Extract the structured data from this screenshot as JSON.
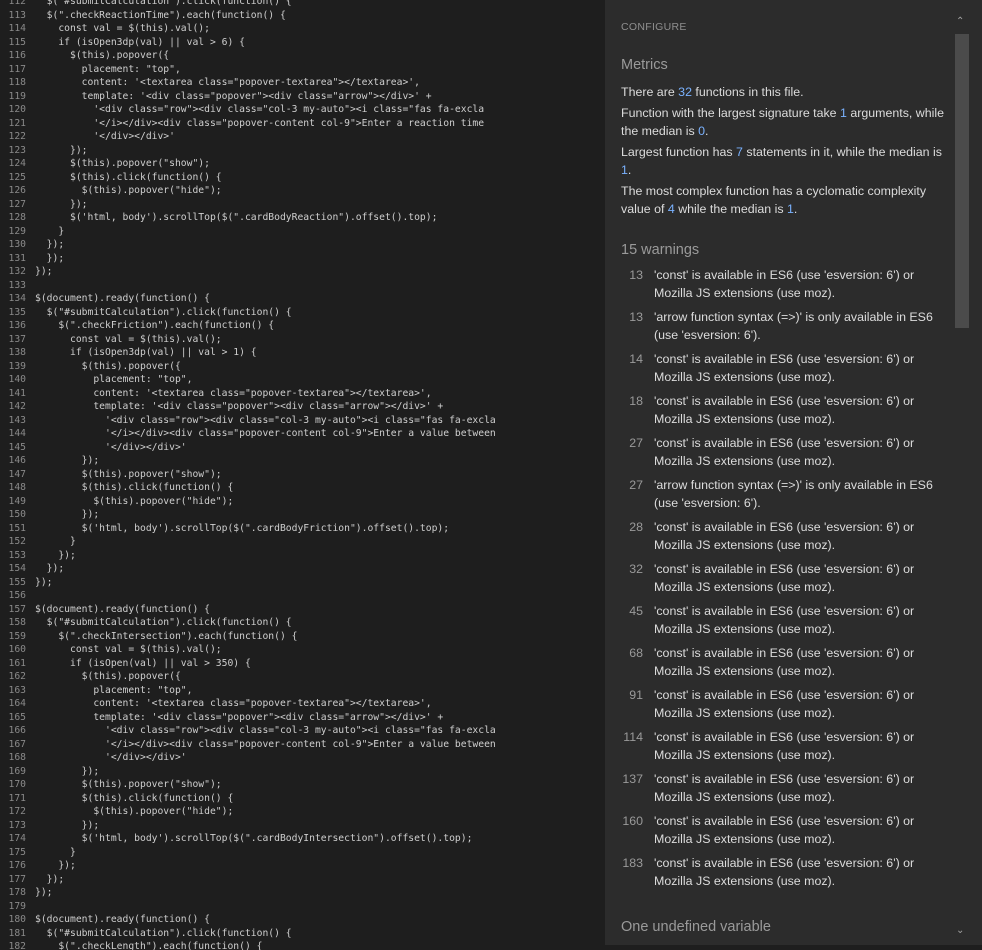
{
  "code_lines": [
    {
      "n": "112",
      "t": "  $(\"#submitCalculation\").click(function() {"
    },
    {
      "n": "113",
      "t": "  $(\".checkReactionTime\").each(function() {"
    },
    {
      "n": "114",
      "t": "    const val = $(this).val();"
    },
    {
      "n": "115",
      "t": "    if (isOpen3dp(val) || val > 6) {"
    },
    {
      "n": "116",
      "t": "      $(this).popover({"
    },
    {
      "n": "117",
      "t": "        placement: \"top\","
    },
    {
      "n": "118",
      "t": "        content: '<textarea class=\"popover-textarea\"></textarea>',"
    },
    {
      "n": "119",
      "t": "        template: '<div class=\"popover\"><div class=\"arrow\"></div>' +"
    },
    {
      "n": "120",
      "t": "          '<div class=\"row\"><div class=\"col-3 my-auto\"><i class=\"fas fa-excla"
    },
    {
      "n": "121",
      "t": "          '</i></div><div class=\"popover-content col-9\">Enter a reaction time"
    },
    {
      "n": "122",
      "t": "          '</div></div>'"
    },
    {
      "n": "123",
      "t": "      });"
    },
    {
      "n": "124",
      "t": "      $(this).popover(\"show\");"
    },
    {
      "n": "125",
      "t": "      $(this).click(function() {"
    },
    {
      "n": "126",
      "t": "        $(this).popover(\"hide\");"
    },
    {
      "n": "127",
      "t": "      });"
    },
    {
      "n": "128",
      "t": "      $('html, body').scrollTop($(\".cardBodyReaction\").offset().top);"
    },
    {
      "n": "129",
      "t": "    }"
    },
    {
      "n": "130",
      "t": "  });"
    },
    {
      "n": "131",
      "t": "  });"
    },
    {
      "n": "132",
      "t": "});"
    },
    {
      "n": "133",
      "t": ""
    },
    {
      "n": "134",
      "t": "$(document).ready(function() {"
    },
    {
      "n": "135",
      "t": "  $(\"#submitCalculation\").click(function() {"
    },
    {
      "n": "136",
      "t": "    $(\".checkFriction\").each(function() {"
    },
    {
      "n": "137",
      "t": "      const val = $(this).val();"
    },
    {
      "n": "138",
      "t": "      if (isOpen3dp(val) || val > 1) {"
    },
    {
      "n": "139",
      "t": "        $(this).popover({"
    },
    {
      "n": "140",
      "t": "          placement: \"top\","
    },
    {
      "n": "141",
      "t": "          content: '<textarea class=\"popover-textarea\"></textarea>',"
    },
    {
      "n": "142",
      "t": "          template: '<div class=\"popover\"><div class=\"arrow\"></div>' +"
    },
    {
      "n": "143",
      "t": "            '<div class=\"row\"><div class=\"col-3 my-auto\"><i class=\"fas fa-excla"
    },
    {
      "n": "144",
      "t": "            '</i></div><div class=\"popover-content col-9\">Enter a value between"
    },
    {
      "n": "145",
      "t": "            '</div></div>'"
    },
    {
      "n": "146",
      "t": "        });"
    },
    {
      "n": "147",
      "t": "        $(this).popover(\"show\");"
    },
    {
      "n": "148",
      "t": "        $(this).click(function() {"
    },
    {
      "n": "149",
      "t": "          $(this).popover(\"hide\");"
    },
    {
      "n": "150",
      "t": "        });"
    },
    {
      "n": "151",
      "t": "        $('html, body').scrollTop($(\".cardBodyFriction\").offset().top);"
    },
    {
      "n": "152",
      "t": "      }"
    },
    {
      "n": "153",
      "t": "    });"
    },
    {
      "n": "154",
      "t": "  });"
    },
    {
      "n": "155",
      "t": "});"
    },
    {
      "n": "156",
      "t": ""
    },
    {
      "n": "157",
      "t": "$(document).ready(function() {"
    },
    {
      "n": "158",
      "t": "  $(\"#submitCalculation\").click(function() {"
    },
    {
      "n": "159",
      "t": "    $(\".checkIntersection\").each(function() {"
    },
    {
      "n": "160",
      "t": "      const val = $(this).val();"
    },
    {
      "n": "161",
      "t": "      if (isOpen(val) || val > 350) {"
    },
    {
      "n": "162",
      "t": "        $(this).popover({"
    },
    {
      "n": "163",
      "t": "          placement: \"top\","
    },
    {
      "n": "164",
      "t": "          content: '<textarea class=\"popover-textarea\"></textarea>',"
    },
    {
      "n": "165",
      "t": "          template: '<div class=\"popover\"><div class=\"arrow\"></div>' +"
    },
    {
      "n": "166",
      "t": "            '<div class=\"row\"><div class=\"col-3 my-auto\"><i class=\"fas fa-excla"
    },
    {
      "n": "167",
      "t": "            '</i></div><div class=\"popover-content col-9\">Enter a value between"
    },
    {
      "n": "168",
      "t": "            '</div></div>'"
    },
    {
      "n": "169",
      "t": "        });"
    },
    {
      "n": "170",
      "t": "        $(this).popover(\"show\");"
    },
    {
      "n": "171",
      "t": "        $(this).click(function() {"
    },
    {
      "n": "172",
      "t": "          $(this).popover(\"hide\");"
    },
    {
      "n": "173",
      "t": "        });"
    },
    {
      "n": "174",
      "t": "        $('html, body').scrollTop($(\".cardBodyIntersection\").offset().top);"
    },
    {
      "n": "175",
      "t": "      }"
    },
    {
      "n": "176",
      "t": "    });"
    },
    {
      "n": "177",
      "t": "  });"
    },
    {
      "n": "178",
      "t": "});"
    },
    {
      "n": "179",
      "t": ""
    },
    {
      "n": "180",
      "t": "$(document).ready(function() {"
    },
    {
      "n": "181",
      "t": "  $(\"#submitCalculation\").click(function() {"
    },
    {
      "n": "182",
      "t": "    $(\".checkLength\").each(function() {"
    }
  ],
  "panel": {
    "configure_label": "CONFIGURE",
    "metrics_title": "Metrics",
    "metrics": {
      "functions_count": "32",
      "largest_signature_args": "1",
      "median_signature": "0",
      "largest_statements": "7",
      "median_statements": "1",
      "max_complexity": "4",
      "median_complexity": "1"
    },
    "warnings_title": "15 warnings",
    "warnings": [
      {
        "line": "13",
        "msg": "'const' is available in ES6 (use 'esversion: 6') or Mozilla JS extensions (use moz)."
      },
      {
        "line": "13",
        "msg": "'arrow function syntax (=>)' is only available in ES6 (use 'esversion: 6')."
      },
      {
        "line": "14",
        "msg": "'const' is available in ES6 (use 'esversion: 6') or Mozilla JS extensions (use moz)."
      },
      {
        "line": "18",
        "msg": "'const' is available in ES6 (use 'esversion: 6') or Mozilla JS extensions (use moz)."
      },
      {
        "line": "27",
        "msg": "'const' is available in ES6 (use 'esversion: 6') or Mozilla JS extensions (use moz)."
      },
      {
        "line": "27",
        "msg": "'arrow function syntax (=>)' is only available in ES6 (use 'esversion: 6')."
      },
      {
        "line": "28",
        "msg": "'const' is available in ES6 (use 'esversion: 6') or Mozilla JS extensions (use moz)."
      },
      {
        "line": "32",
        "msg": "'const' is available in ES6 (use 'esversion: 6') or Mozilla JS extensions (use moz)."
      },
      {
        "line": "45",
        "msg": "'const' is available in ES6 (use 'esversion: 6') or Mozilla JS extensions (use moz)."
      },
      {
        "line": "68",
        "msg": "'const' is available in ES6 (use 'esversion: 6') or Mozilla JS extensions (use moz)."
      },
      {
        "line": "91",
        "msg": "'const' is available in ES6 (use 'esversion: 6') or Mozilla JS extensions (use moz)."
      },
      {
        "line": "114",
        "msg": "'const' is available in ES6 (use 'esversion: 6') or Mozilla JS extensions (use moz)."
      },
      {
        "line": "137",
        "msg": "'const' is available in ES6 (use 'esversion: 6') or Mozilla JS extensions (use moz)."
      },
      {
        "line": "160",
        "msg": "'const' is available in ES6 (use 'esversion: 6') or Mozilla JS extensions (use moz)."
      },
      {
        "line": "183",
        "msg": "'const' is available in ES6 (use 'esversion: 6') or Mozilla JS extensions (use moz)."
      }
    ],
    "undefined_title": "One undefined variable"
  },
  "icons": {
    "scroll_up": "chevron-up-icon",
    "scroll_down": "chevron-down-icon"
  },
  "colors": {
    "background": "#1e1e1e",
    "panel": "#2c2c2c",
    "accent_number": "#7ab2ff",
    "keyword": "#6ec0ff"
  }
}
